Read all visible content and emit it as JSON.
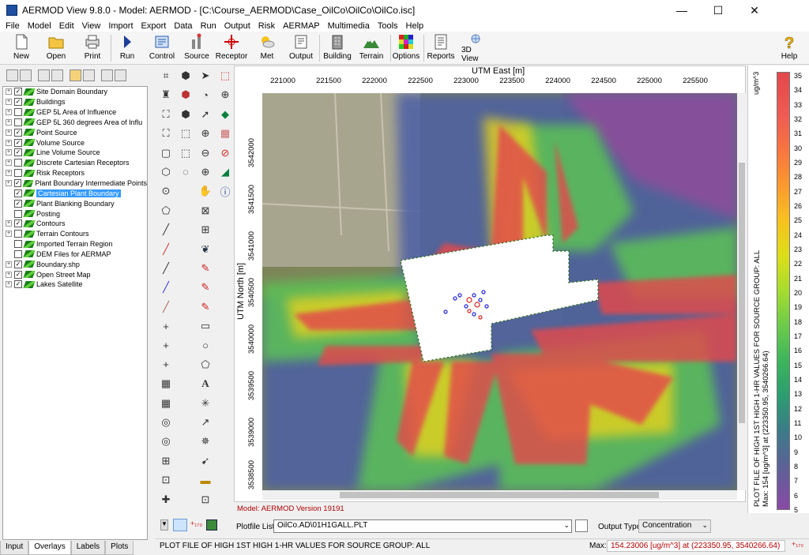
{
  "window": {
    "title": "AERMOD View 9.8.0 - Model: AERMOD - [C:\\Course_AERMOD\\Case_OilCo\\OilCo\\OilCo.isc]",
    "minimize": "—",
    "maximize": "☐",
    "close": "✕"
  },
  "menu": [
    "File",
    "Model",
    "Edit",
    "View",
    "Import",
    "Export",
    "Data",
    "Run",
    "Output",
    "Risk",
    "AERMAP",
    "Multimedia",
    "Tools",
    "Help"
  ],
  "toolbar": [
    {
      "label": "New",
      "icon": "new-file-icon"
    },
    {
      "label": "Open",
      "icon": "open-folder-icon"
    },
    {
      "label": "Print",
      "icon": "printer-icon"
    },
    {
      "label": "Run",
      "icon": "run-arrow-icon"
    },
    {
      "label": "Control",
      "icon": "control-icon"
    },
    {
      "label": "Source",
      "icon": "source-icon"
    },
    {
      "label": "Receptor",
      "icon": "receptor-icon"
    },
    {
      "label": "Met",
      "icon": "met-icon"
    },
    {
      "label": "Output",
      "icon": "output-icon"
    },
    {
      "label": "Building",
      "icon": "building-icon"
    },
    {
      "label": "Terrain",
      "icon": "terrain-icon"
    },
    {
      "label": "Options",
      "icon": "options-icon"
    },
    {
      "label": "Reports",
      "icon": "reports-icon"
    },
    {
      "label": "3D View",
      "icon": "3d-view-icon"
    },
    {
      "label": "Help",
      "icon": "help-icon"
    }
  ],
  "layers": [
    {
      "label": "Site Domain Boundary",
      "checked": true,
      "expandable": true
    },
    {
      "label": "Buildings",
      "checked": true,
      "expandable": true
    },
    {
      "label": "GEP 5L Area of Influence",
      "checked": false,
      "expandable": true
    },
    {
      "label": "GEP 5L 360 degrees Area of Influ",
      "checked": false,
      "expandable": true
    },
    {
      "label": "Point Source",
      "checked": true,
      "expandable": true
    },
    {
      "label": "Volume Source",
      "checked": true,
      "expandable": true
    },
    {
      "label": "Line Volume Source",
      "checked": true,
      "expandable": true
    },
    {
      "label": "Discrete Cartesian Receptors",
      "checked": false,
      "expandable": true
    },
    {
      "label": "Risk Receptors",
      "checked": false,
      "expandable": true
    },
    {
      "label": "Plant Boundary Intermediate Points",
      "checked": true,
      "expandable": true
    },
    {
      "label": "Cartesian Plant Boundary",
      "checked": true,
      "expandable": false,
      "selected": true
    },
    {
      "label": "Plant Blanking Boundary",
      "checked": true,
      "expandable": false
    },
    {
      "label": "Posting",
      "checked": false,
      "expandable": false
    },
    {
      "label": "Contours",
      "checked": true,
      "expandable": true
    },
    {
      "label": "Terrain Contours",
      "checked": false,
      "expandable": true
    },
    {
      "label": "Imported Terrain Region",
      "checked": false,
      "expandable": false
    },
    {
      "label": "DEM Files for AERMAP",
      "checked": false,
      "expandable": false
    },
    {
      "label": "Boundary.shp",
      "checked": true,
      "expandable": true
    },
    {
      "label": "Open Street Map",
      "checked": true,
      "expandable": true
    },
    {
      "label": "Lakes Satellite",
      "checked": true,
      "expandable": true
    }
  ],
  "left_tabs": [
    "Input",
    "Overlays",
    "Labels",
    "Plots"
  ],
  "active_left_tab": "Overlays",
  "map": {
    "x_axis_title": "UTM East [m]",
    "y_axis_title": "UTM North [m]",
    "x_ticks": [
      "221000",
      "221500",
      "222000",
      "222500",
      "223000",
      "223500",
      "224000",
      "224500",
      "225000",
      "225500"
    ],
    "y_ticks": [
      "3542000",
      "3541500",
      "3541000",
      "3540500",
      "3540000",
      "3539500",
      "3539000",
      "3538500"
    ],
    "model_version": "Model: AERMOD Version 19191"
  },
  "legend": {
    "unit": "ug/m^3",
    "ticks": [
      "35",
      "34",
      "33",
      "32",
      "31",
      "30",
      "29",
      "28",
      "27",
      "26",
      "25",
      "24",
      "23",
      "22",
      "21",
      "20",
      "19",
      "18",
      "17",
      "16",
      "15",
      "14",
      "13",
      "12",
      "11",
      "10",
      "9",
      "8",
      "7",
      "6",
      "5"
    ],
    "vertical_text": "PLOT FILE OF HIGH 1ST HIGH 1-HR VALUES FOR SOURCE GROUP: ALL",
    "vertical_max": "Max:  154  [ug/m^3]  at   (223350.95, 3540266.64)",
    "colors": {
      "high": "#e3484b",
      "mid": "#a6dc2f",
      "low": "#8a4aa6"
    }
  },
  "controls": {
    "plotfile_label": "Plotfile List:",
    "plotfile_value": "OilCo.AD\\01H1GALL.PLT",
    "output_type_label": "Output Type:",
    "output_type_value": "Concentration"
  },
  "status": {
    "left": "PLOT FILE OF HIGH 1ST HIGH 1-HR VALUES FOR SOURCE GROUP: ALL",
    "max_label": "Max:",
    "max_value": "154.23006  [ug/m^3]  at   (223350.95, 3540266.64)"
  }
}
